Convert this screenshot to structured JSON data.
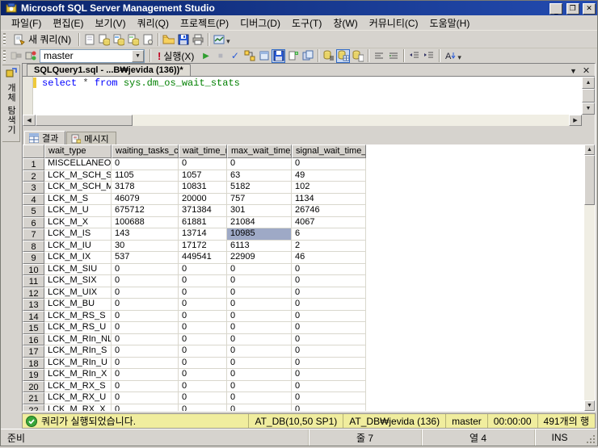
{
  "window": {
    "title": "Microsoft SQL Server Management Studio",
    "controls": {
      "minimize": "_",
      "maximize": "❐",
      "close": "✕"
    }
  },
  "menu": {
    "items": [
      "파일(F)",
      "편집(E)",
      "보기(V)",
      "쿼리(Q)",
      "프로젝트(P)",
      "디버그(D)",
      "도구(T)",
      "창(W)",
      "커뮤니티(C)",
      "도움말(H)"
    ]
  },
  "toolbar_standard": {
    "new_query_label": "새 쿼리(N)"
  },
  "toolbar_sql": {
    "database": "master",
    "execute_bang": "!",
    "execute_label": "실행(X)"
  },
  "object_explorer": {
    "tab_label": "개체 탐색기"
  },
  "editor": {
    "tab_title": "SQLQuery1.sql - ...B₩jevida (136))*",
    "code": [
      {
        "text": "select",
        "color": "#0000ff"
      },
      {
        "text": " * ",
        "color": "#444444"
      },
      {
        "text": "from",
        "color": "#0000ff"
      },
      {
        "text": " sys.dm_os_wait_stats",
        "color": "#008000"
      }
    ]
  },
  "results": {
    "tabs": {
      "results": "결과",
      "messages": "메시지"
    },
    "columns": [
      "wait_type",
      "waiting_tasks_count",
      "wait_time_ms",
      "max_wait_time_ms",
      "signal_wait_time_ms"
    ],
    "rows": [
      [
        "MISCELLANEOUS",
        "0",
        "0",
        "0",
        "0"
      ],
      [
        "LCK_M_SCH_S",
        "1105",
        "1057",
        "63",
        "49"
      ],
      [
        "LCK_M_SCH_M",
        "3178",
        "10831",
        "5182",
        "102"
      ],
      [
        "LCK_M_S",
        "46079",
        "20000",
        "757",
        "1134"
      ],
      [
        "LCK_M_U",
        "675712",
        "371384",
        "301",
        "26746"
      ],
      [
        "LCK_M_X",
        "100688",
        "61881",
        "21084",
        "4067"
      ],
      [
        "LCK_M_IS",
        "143",
        "13714",
        "10985",
        "6"
      ],
      [
        "LCK_M_IU",
        "30",
        "17172",
        "6113",
        "2"
      ],
      [
        "LCK_M_IX",
        "537",
        "449541",
        "22909",
        "46"
      ],
      [
        "LCK_M_SIU",
        "0",
        "0",
        "0",
        "0"
      ],
      [
        "LCK_M_SIX",
        "0",
        "0",
        "0",
        "0"
      ],
      [
        "LCK_M_UIX",
        "0",
        "0",
        "0",
        "0"
      ],
      [
        "LCK_M_BU",
        "0",
        "0",
        "0",
        "0"
      ],
      [
        "LCK_M_RS_S",
        "0",
        "0",
        "0",
        "0"
      ],
      [
        "LCK_M_RS_U",
        "0",
        "0",
        "0",
        "0"
      ],
      [
        "LCK_M_RIn_NL",
        "0",
        "0",
        "0",
        "0"
      ],
      [
        "LCK_M_RIn_S",
        "0",
        "0",
        "0",
        "0"
      ],
      [
        "LCK_M_RIn_U",
        "0",
        "0",
        "0",
        "0"
      ],
      [
        "LCK_M_RIn_X",
        "0",
        "0",
        "0",
        "0"
      ],
      [
        "LCK_M_RX_S",
        "0",
        "0",
        "0",
        "0"
      ],
      [
        "LCK_M_RX_U",
        "0",
        "0",
        "0",
        "0"
      ],
      [
        "LCK_M_RX_X",
        "0",
        "0",
        "0",
        "0"
      ]
    ],
    "selected_cell": {
      "row_index": 6,
      "col_index": 3
    }
  },
  "query_status": {
    "message": "쿼리가 실행되었습니다.",
    "segments": [
      "AT_DB(10,50 SP1)",
      "AT_DB₩jevida (136)",
      "master",
      "00:00:00",
      "491개의 행"
    ]
  },
  "statusbar": {
    "ready": "준비",
    "line": "줄 7",
    "column": "열 4",
    "mode": "INS"
  },
  "glyphs": {
    "up": "▲",
    "down": "▼",
    "left": "◀",
    "right": "▶",
    "dropdown": "▼",
    "overflow": "▾",
    "play": "▶",
    "stop": "■",
    "check": "✓"
  },
  "colors": {
    "titlebar": "#0a246a",
    "chrome": "#d6d3ce",
    "status_yellow": "#f0ed9e",
    "cell_selection": "#9ea9c6",
    "sql_keyword": "#0000ff",
    "sql_system_object": "#008000"
  },
  "icons": [
    "app-icon",
    "new-query-icon",
    "new-document-icon",
    "database-query-icon",
    "analysis-query-icon",
    "dmx-query-icon",
    "blank-page-icon",
    "open-file-icon",
    "save-icon",
    "print-icon",
    "activity-monitor-icon",
    "connect-icon",
    "change-connection-icon",
    "execute-bang-icon",
    "debug-play-icon",
    "cancel-stop-icon",
    "parse-check-icon",
    "estimated-plan-icon",
    "query-options-icon",
    "design-query-icon",
    "template-parameters-icon",
    "client-statistics-icon",
    "results-to-text-icon",
    "results-to-grid-icon",
    "results-to-file-icon",
    "comment-icon",
    "uncomment-icon",
    "indent-icon",
    "outdent-icon",
    "intellisense-icon",
    "object-explorer-icon",
    "results-grid-tab-icon",
    "messages-tab-icon",
    "success-check-icon",
    "resize-grip-icon"
  ]
}
